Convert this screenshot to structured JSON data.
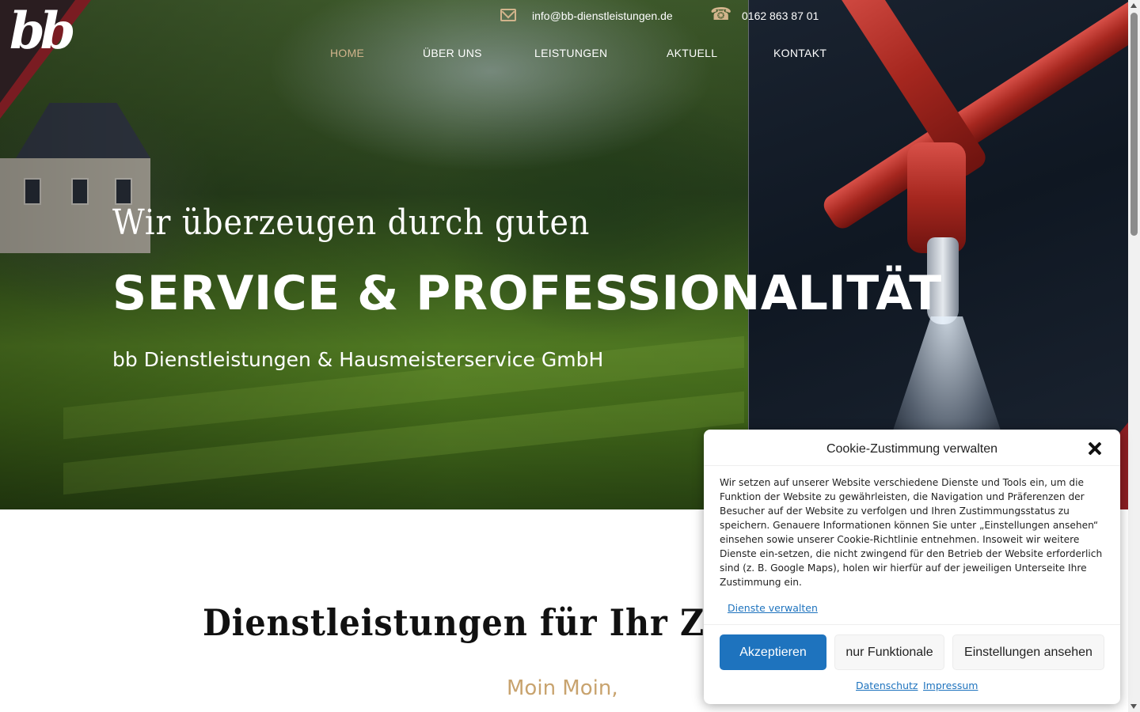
{
  "brand": {
    "logo_text": "bb"
  },
  "contact": {
    "email": "info@bb-dienstleistungen.de",
    "phone": "0162 863 87 01"
  },
  "nav": {
    "items": [
      {
        "label": "HOME",
        "active": true
      },
      {
        "label": "ÜBER UNS",
        "active": false
      },
      {
        "label": "LEISTUNGEN",
        "active": false
      },
      {
        "label": "AKTUELL",
        "active": false
      },
      {
        "label": "KONTAKT",
        "active": false
      }
    ]
  },
  "hero": {
    "subtitle": "Wir überzeugen durch guten",
    "title": "SERVICE & PROFESSIONALITÄT",
    "company": "bb Dienstleistungen & Hausmeisterservice GmbH"
  },
  "content": {
    "heading": "Dienstleistungen für Ihr Zuhause u",
    "greeting": "Moin Moin,"
  },
  "cookie": {
    "title": "Cookie-Zustimmung verwalten",
    "body": "Wir setzen auf unserer Website verschiedene Dienste und Tools ein, um die Funktion der Website zu gewährleisten, die Navigation und Präferenzen der Besucher auf der Website zu verfolgen und Ihren Zustimmungsstatus zu speichern. Genauere Informationen können Sie unter „Einstellungen ansehen“ einsehen sowie unserer Cookie-Richtlinie entnehmen. Insoweit wir weitere Dienste ein-setzen, die nicht zwingend für den Betrieb der Website erforderlich sind (z. B. Google Maps), holen wir hierfür auf der jeweiligen Unterseite Ihre Zustimmung ein.",
    "manage_link": "Dienste verwalten",
    "accept_label": "Akzeptieren",
    "functional_label": "nur Funktionale",
    "settings_label": "Einstellungen ansehen",
    "privacy_link": "Datenschutz",
    "imprint_link": "Impressum"
  },
  "colors": {
    "accent_gold": "#d2b48c",
    "primary_blue": "#1e73be",
    "brand_red": "#8b1e22",
    "greeting_gold": "#c8a36e"
  },
  "icons": [
    "mail-icon",
    "phone-icon",
    "close-icon"
  ]
}
